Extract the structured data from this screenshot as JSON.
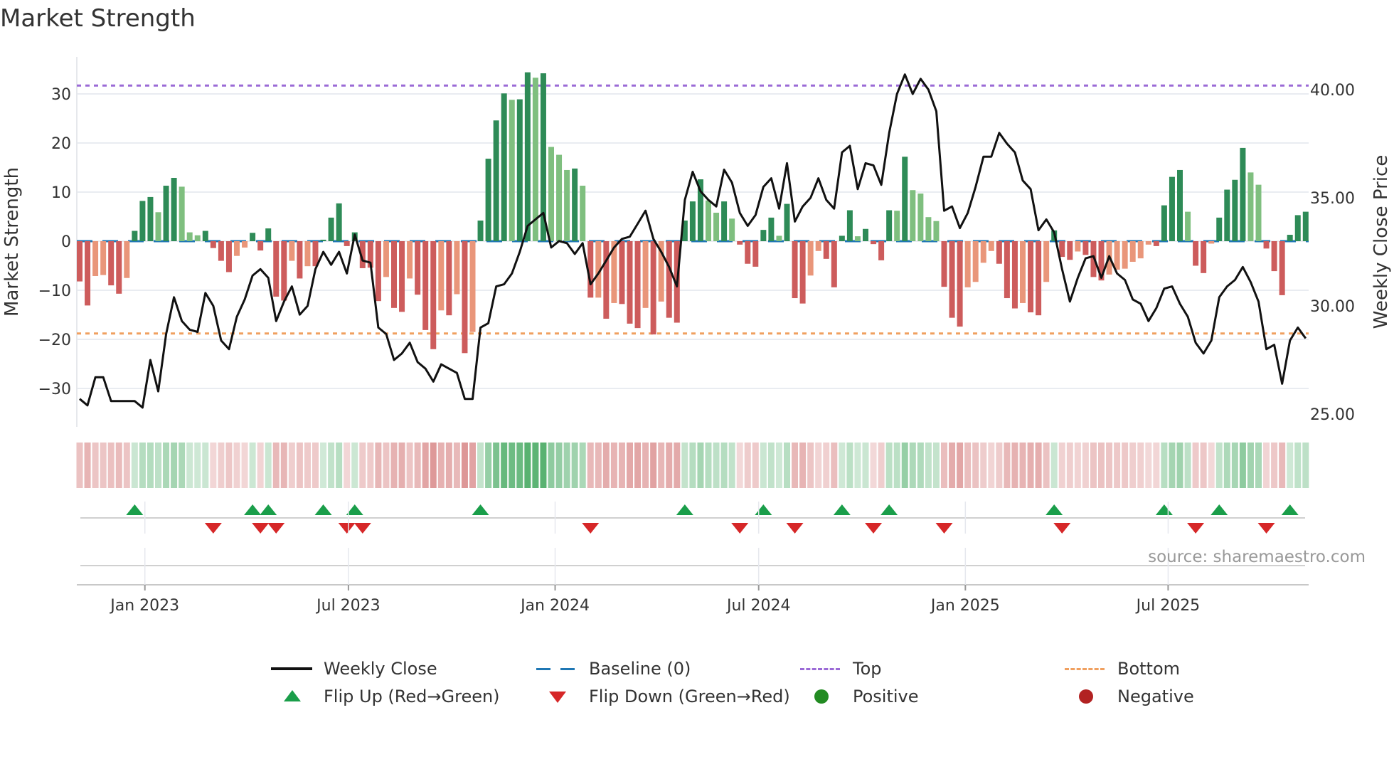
{
  "title": "Market Strength",
  "source": "source: sharemaestro.com",
  "legend": {
    "weekly_close": "Weekly Close",
    "baseline": "Baseline (0)",
    "top": "Top",
    "bottom": "Bottom",
    "flip_up": "Flip Up (Red→Green)",
    "flip_down": "Flip Down (Green→Red)",
    "positive": "Positive",
    "negative": "Negative"
  },
  "colors": {
    "strong_green": "#2e8b57",
    "weak_green": "#7fbf7f",
    "strong_red": "#cd5c5c",
    "weak_red": "#e9967a",
    "price": "#111111",
    "baseline": "#1f77b4",
    "top": "#9b6ad6",
    "bottom": "#f0a060",
    "flip_up": "#1a9e4a",
    "flip_down": "#d62728",
    "positive": "#228b22",
    "negative": "#b22222"
  },
  "chart_data": {
    "type": "bar",
    "title": "Market Strength",
    "ylabel": "Market Strength",
    "y2label": "Weekly Close Price",
    "ylim": [
      -37,
      38
    ],
    "y2lim": [
      24.4,
      41.6
    ],
    "yticks": [
      30,
      20,
      10,
      0,
      -10,
      -20,
      -30
    ],
    "ytick_labels": [
      "30",
      "20",
      "10",
      "0",
      "−10",
      "−20",
      "−30"
    ],
    "y2ticks": [
      40,
      35,
      30,
      25
    ],
    "y2tick_labels": [
      "40.00",
      "35.00",
      "30.00",
      "25.00"
    ],
    "xticks": [
      {
        "week": 9.3,
        "label": "Jan 2023"
      },
      {
        "week": 35.2,
        "label": "Jul 2023"
      },
      {
        "week": 61.5,
        "label": "Jan 2024"
      },
      {
        "week": 87.4,
        "label": "Jul 2024"
      },
      {
        "week": 113.7,
        "label": "Jan 2025"
      },
      {
        "week": 139.5,
        "label": "Jul 2025"
      }
    ],
    "top_level": 31.7,
    "bottom_level": -18.8,
    "baseline": 0,
    "strength": [
      -8.2,
      -13.1,
      -7.1,
      -6.9,
      -9.0,
      -10.7,
      -7.5,
      2.1,
      8.2,
      9.0,
      5.9,
      11.3,
      12.9,
      11.1,
      1.8,
      1.2,
      2.1,
      -1.4,
      -4.0,
      -6.3,
      -3.0,
      -1.3,
      1.7,
      -1.9,
      2.6,
      -11.3,
      -12.1,
      -4.0,
      -7.6,
      -5.1,
      -5.1,
      0.3,
      4.8,
      7.7,
      -1.0,
      1.8,
      -5.5,
      -5.4,
      -12.2,
      -7.3,
      -13.6,
      -14.4,
      -7.6,
      -10.9,
      -18.1,
      -22.0,
      -14.1,
      -15.1,
      -10.8,
      -22.8,
      -18.5,
      4.2,
      16.8,
      24.6,
      30.1,
      28.8,
      28.9,
      34.4,
      33.3,
      34.2,
      19.2,
      17.6,
      14.5,
      14.8,
      11.3,
      -11.5,
      -11.5,
      -15.8,
      -12.6,
      -12.8,
      -16.8,
      -17.7,
      -13.6,
      -19.0,
      -12.3,
      -15.6,
      -16.6,
      4.2,
      8.1,
      12.6,
      8.3,
      5.8,
      8.1,
      4.6,
      -0.7,
      -4.6,
      -5.2,
      2.3,
      4.8,
      1.1,
      7.6,
      -11.6,
      -12.7,
      -7.0,
      -2.0,
      -3.6,
      -9.4,
      1.1,
      6.3,
      1.0,
      2.5,
      -0.6,
      -3.9,
      6.3,
      6.2,
      17.2,
      10.4,
      9.7,
      4.9,
      4.1,
      -9.3,
      -15.6,
      -17.4,
      -9.4,
      -8.3,
      -4.4,
      -2.0,
      -4.6,
      -11.6,
      -13.7,
      -12.6,
      -14.5,
      -15.1,
      -8.3,
      2.2,
      -3.2,
      -3.8,
      -2.1,
      -2.8,
      -7.3,
      -8.0,
      -6.8,
      -5.8,
      -5.6,
      -4.2,
      -3.5,
      -0.7,
      -1.0,
      7.3,
      13.1,
      14.5,
      6.0,
      -5.0,
      -6.5,
      -0.5,
      4.8,
      10.5,
      12.5,
      19.0,
      14.0,
      11.5,
      -1.5,
      -6.1,
      -11.0,
      1.3,
      5.3,
      6.0
    ],
    "shade": "ddllddlddd",
    "shade_all": "ddllddldddlddllllddddlldddddldldddddddddlddldddldldlddddlddldllldldldldddldldddddlldldddddldddllddddlddddldllllddddllllddd lddldddlddd llllllddddlddlddddllddddddd",
    "price": [
      25.7,
      25.4,
      26.7,
      26.7,
      25.6,
      25.6,
      25.6,
      25.6,
      25.3,
      27.5,
      26.05,
      28.7,
      30.4,
      29.3,
      28.9,
      28.8,
      30.6,
      30.0,
      28.4,
      28.0,
      29.5,
      30.3,
      31.4,
      31.7,
      31.3,
      29.3,
      30.2,
      30.9,
      29.6,
      30.0,
      31.7,
      32.5,
      31.9,
      32.5,
      31.5,
      33.3,
      32.1,
      32.0,
      29.0,
      28.7,
      27.5,
      27.8,
      28.3,
      27.4,
      27.1,
      26.5,
      27.3,
      27.1,
      26.9,
      25.7,
      25.7,
      29.0,
      29.2,
      30.9,
      31.0,
      31.5,
      32.5,
      33.7,
      34.0,
      34.3,
      32.7,
      33.0,
      32.9,
      32.4,
      32.9,
      31.0,
      31.5,
      32.1,
      32.7,
      33.1,
      33.2,
      33.8,
      34.4,
      33.1,
      32.5,
      31.8,
      30.9,
      34.9,
      36.2,
      35.3,
      34.9,
      34.6,
      36.3,
      35.7,
      34.3,
      33.7,
      34.2,
      35.5,
      35.9,
      34.5,
      36.6,
      33.9,
      34.6,
      35.0,
      35.9,
      34.9,
      34.5,
      37.1,
      37.4,
      35.4,
      36.6,
      36.5,
      35.6,
      38.0,
      39.8,
      40.7,
      39.8,
      40.5,
      40.0,
      39.0,
      34.4,
      34.6,
      33.6,
      34.3,
      35.5,
      36.9,
      36.9,
      38.0,
      37.5,
      37.1,
      35.8,
      35.4,
      33.5,
      34.0,
      33.4,
      31.7,
      30.2,
      31.3,
      32.2,
      32.3,
      31.3,
      32.3,
      31.5,
      31.2,
      30.3,
      30.1,
      29.3,
      29.9,
      30.8,
      30.9,
      30.1,
      29.5,
      28.3,
      27.8,
      28.4,
      30.4,
      30.9,
      31.2,
      31.8,
      31.1,
      30.2,
      28.0,
      28.2,
      26.4,
      28.4,
      29.0,
      28.5
    ],
    "light_weeks": [
      3,
      4,
      7,
      11,
      14,
      15,
      16,
      21,
      22,
      28,
      30,
      40,
      43,
      47,
      49,
      51,
      56,
      59,
      61,
      62,
      63,
      65,
      67,
      69,
      73,
      75,
      81,
      82,
      84,
      90,
      94,
      95,
      100,
      105,
      107,
      108,
      109,
      110,
      114,
      115,
      116,
      117,
      121,
      124,
      128,
      132,
      133,
      134,
      135,
      136,
      137,
      142,
      145,
      150,
      151
    ],
    "legend_placement": "bottom"
  }
}
